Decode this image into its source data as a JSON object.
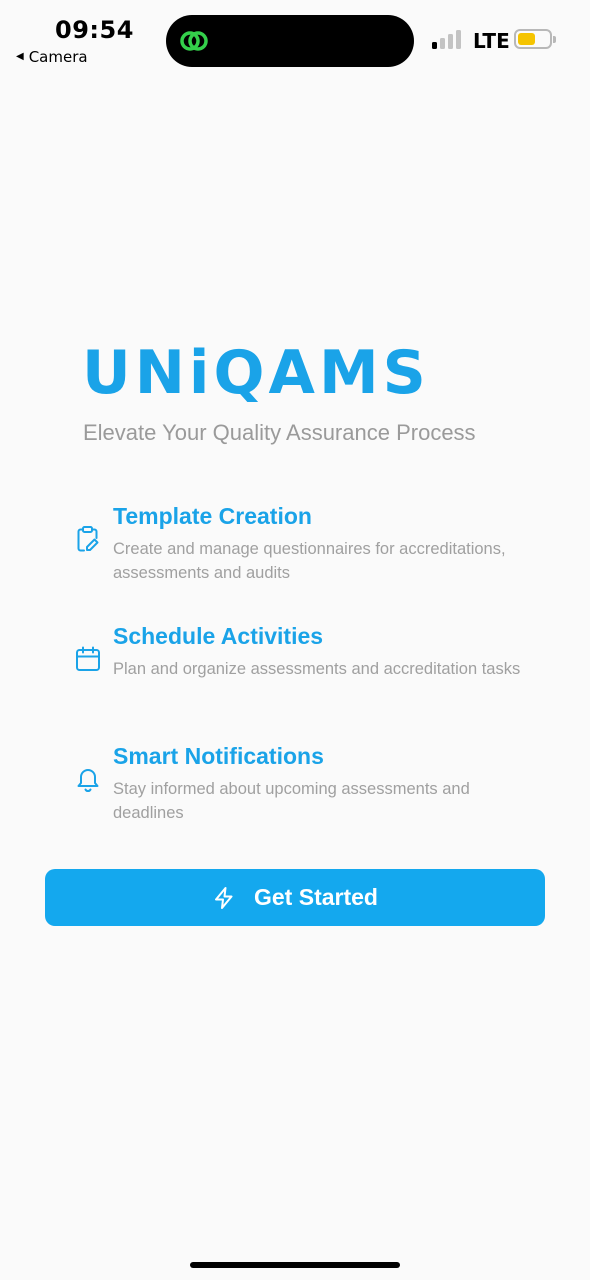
{
  "status_bar": {
    "time": "09:54",
    "back_label": "Camera",
    "carrier": "LTE",
    "battery_level": 0.55
  },
  "brand": {
    "name": "UNiQAMS",
    "tagline": "Elevate Your Quality Assurance Process"
  },
  "features": [
    {
      "icon": "clipboard-edit-icon",
      "title": "Template Creation",
      "description": "Create and manage questionnaires for accreditations, assessments and audits"
    },
    {
      "icon": "calendar-icon",
      "title": "Schedule Activities",
      "description": "Plan and organize assessments and accreditation tasks"
    },
    {
      "icon": "bell-icon",
      "title": "Smart Notifications",
      "description": "Stay informed about upcoming assessments and deadlines"
    }
  ],
  "cta": {
    "icon": "lightning-icon",
    "label": "Get Started"
  },
  "colors": {
    "accent": "#1aa3e8",
    "button": "#14a8ee",
    "muted_text": "#9a9a9a",
    "background": "#fafafa"
  }
}
